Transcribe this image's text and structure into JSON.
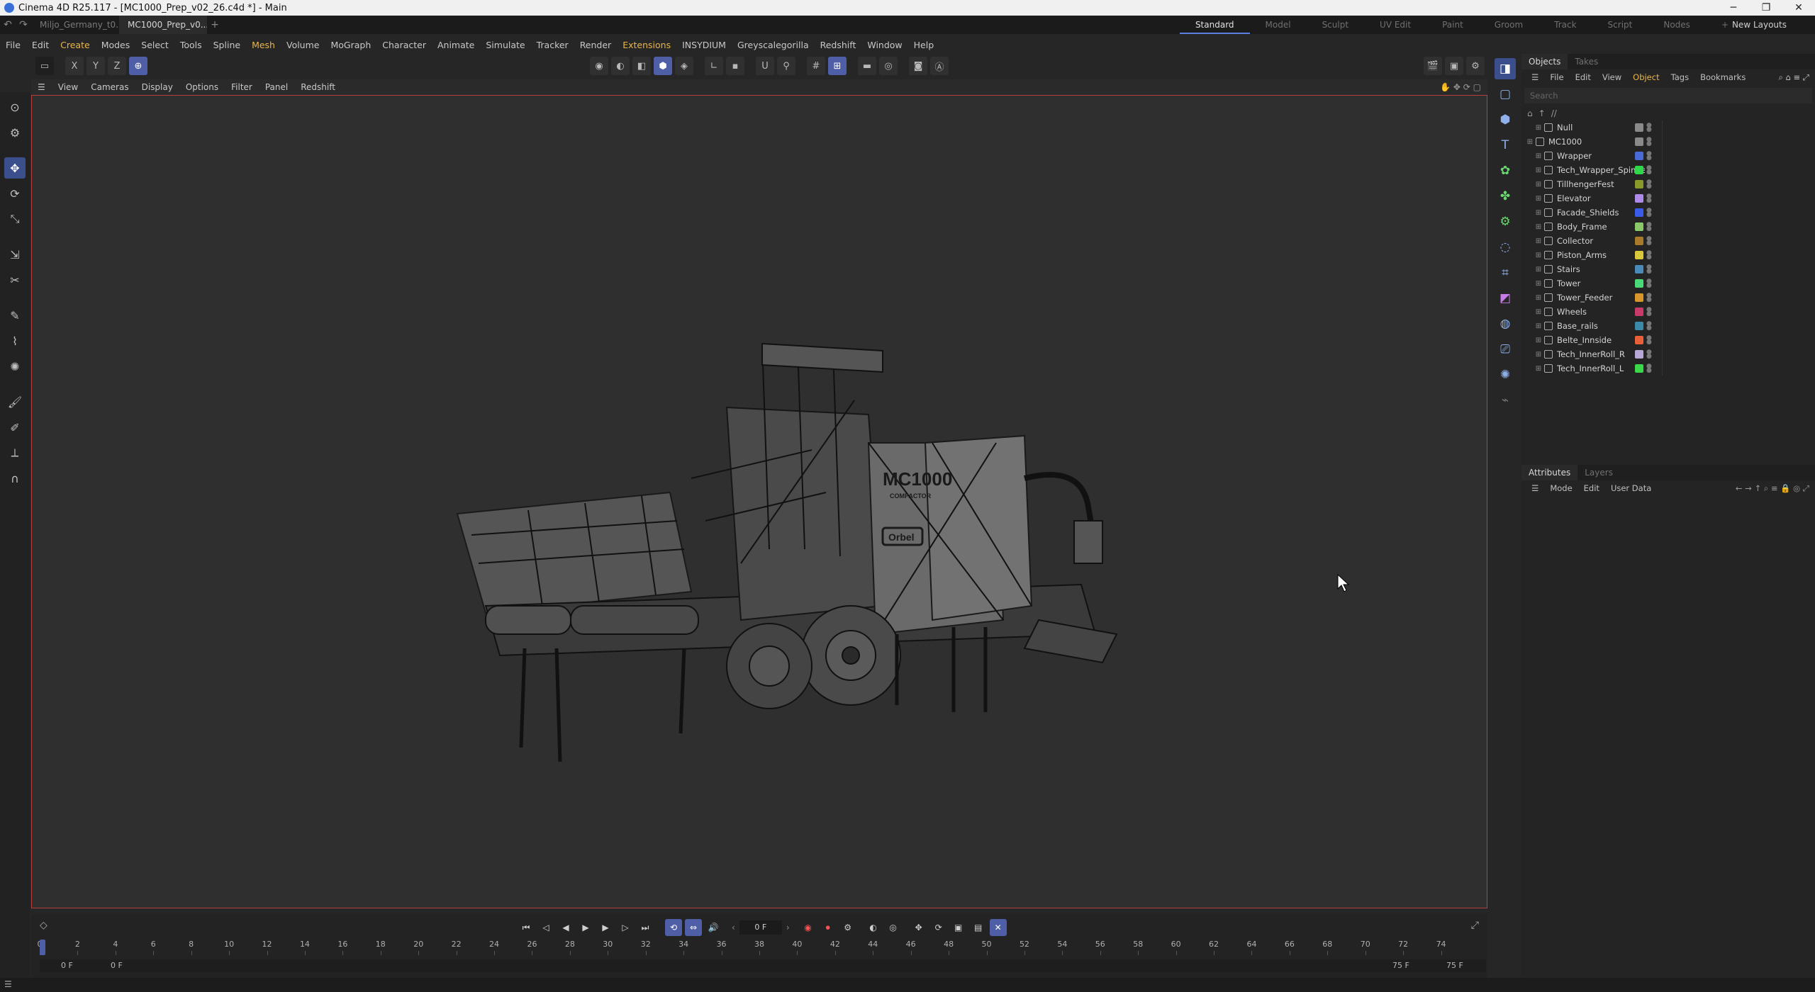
{
  "titlebar": {
    "title": "Cinema 4D R25.117 - [MC1000_Prep_v02_26.c4d *] - Main",
    "minimize": "─",
    "maximize": "❐",
    "close": "✕"
  },
  "tabs": {
    "items": [
      {
        "label": "Miljo_Germany_t0..."
      },
      {
        "label": "MC1000_Prep_v0..."
      }
    ],
    "close": "✕",
    "add": "+"
  },
  "layouts": {
    "items": [
      "Standard",
      "Model",
      "Sculpt",
      "UV Edit",
      "Paint",
      "Groom",
      "Track",
      "Script",
      "Nodes"
    ],
    "add": "+",
    "new_layouts": "New Layouts"
  },
  "menubar": {
    "items": [
      "File",
      "Edit",
      "Create",
      "Modes",
      "Select",
      "Tools",
      "Spline",
      "Mesh",
      "Volume",
      "MoGraph",
      "Character",
      "Animate",
      "Simulate",
      "Tracker",
      "Render",
      "Extensions",
      "INSYDIUM",
      "Greyscalegorilla",
      "Redshift",
      "Window",
      "Help"
    ]
  },
  "toolbar": {
    "axis": [
      "X",
      "Y",
      "Z"
    ]
  },
  "viewport_menu": {
    "items": [
      "View",
      "Cameras",
      "Display",
      "Options",
      "Filter",
      "Panel",
      "Redshift"
    ]
  },
  "model": {
    "logo": "MC1000",
    "sub": "COMPACTOR",
    "brand": "Orbel"
  },
  "objects_panel": {
    "tabs": [
      "Objects",
      "Takes"
    ],
    "menu": [
      "File",
      "Edit",
      "View",
      "Object",
      "Tags",
      "Bookmarks"
    ],
    "search_placeholder": "Search",
    "crumb": "//",
    "rows": [
      {
        "name": "Null",
        "color": "#8a8a8a",
        "indent": 1
      },
      {
        "name": "MC1000",
        "color": "#8a8a8a",
        "indent": 0
      },
      {
        "name": "Wrapper",
        "color": "#4a6ad8",
        "indent": 1
      },
      {
        "name": "Tech_Wrapper_Spinner",
        "color": "#2fd84a",
        "indent": 1
      },
      {
        "name": "TillhengerFest",
        "color": "#8a9a2a",
        "indent": 1
      },
      {
        "name": "Elevator",
        "color": "#b08ae8",
        "indent": 1
      },
      {
        "name": "Facade_Shields",
        "color": "#3a5ae8",
        "indent": 1
      },
      {
        "name": "Body_Frame",
        "color": "#8ac86a",
        "indent": 1
      },
      {
        "name": "Collector",
        "color": "#a87a2a",
        "indent": 1
      },
      {
        "name": "Piston_Arms",
        "color": "#d8c83a",
        "indent": 1
      },
      {
        "name": "Stairs",
        "color": "#4a8ab8",
        "indent": 1
      },
      {
        "name": "Tower",
        "color": "#4ad878",
        "indent": 1
      },
      {
        "name": "Tower_Feeder",
        "color": "#d8962a",
        "indent": 1
      },
      {
        "name": "Wheels",
        "color": "#c83a6a",
        "indent": 1
      },
      {
        "name": "Base_rails",
        "color": "#3a8aa8",
        "indent": 1
      },
      {
        "name": "Belte_Innside",
        "color": "#e8603a",
        "indent": 1
      },
      {
        "name": "Tech_InnerRoll_R",
        "color": "#b8a8d8",
        "indent": 1
      },
      {
        "name": "Tech_InnerRoll_L",
        "color": "#3ad84a",
        "indent": 1
      }
    ]
  },
  "attributes_panel": {
    "tabs": [
      "Attributes",
      "Layers"
    ],
    "menu": [
      "Mode",
      "Edit",
      "User Data"
    ]
  },
  "timeline": {
    "current_frame": "0 F",
    "ticks": [
      "0",
      "2",
      "4",
      "6",
      "8",
      "10",
      "12",
      "14",
      "16",
      "18",
      "20",
      "22",
      "24",
      "26",
      "28",
      "30",
      "32",
      "34",
      "36",
      "38",
      "40",
      "42",
      "44",
      "46",
      "48",
      "50",
      "52",
      "54",
      "56",
      "58",
      "60",
      "62",
      "64",
      "66",
      "68",
      "70",
      "72",
      "74"
    ],
    "range_start": "0 F",
    "range_start2": "0 F",
    "range_end": "75 F",
    "range_end2": "75 F"
  }
}
